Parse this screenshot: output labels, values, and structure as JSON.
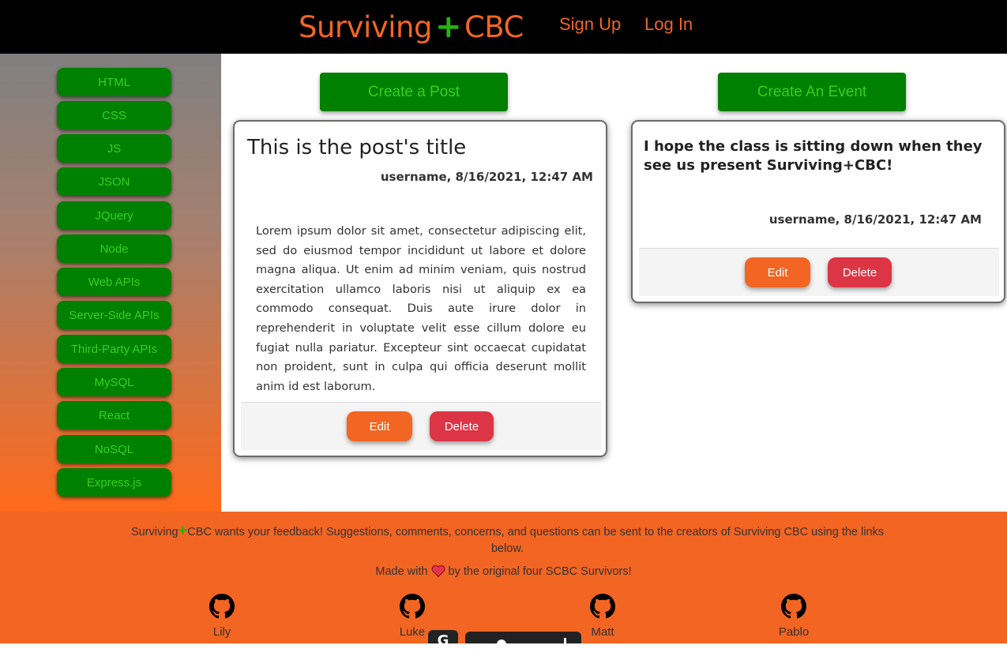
{
  "header": {
    "brand_left": "Surviving",
    "brand_plus": "+",
    "brand_right": "CBC",
    "signup": "Sign Up",
    "login": "Log In"
  },
  "sidebar": {
    "items": [
      {
        "label": "HTML"
      },
      {
        "label": "CSS"
      },
      {
        "label": "JS"
      },
      {
        "label": "JSON"
      },
      {
        "label": "JQuery"
      },
      {
        "label": "Node"
      },
      {
        "label": "Web APIs"
      },
      {
        "label": "Server-Side APIs"
      },
      {
        "label": "Third-Party APIs"
      },
      {
        "label": "MySQL"
      },
      {
        "label": "React"
      },
      {
        "label": "NoSQL"
      },
      {
        "label": "Express.js"
      }
    ]
  },
  "main": {
    "create_post": "Create a Post",
    "create_event": "Create An Event",
    "post": {
      "title": "This is the post's title",
      "meta": "username, 8/16/2021, 12:47 AM",
      "body": "Lorem ipsum dolor sit amet, consectetur adipiscing elit, sed do eiusmod tempor incididunt ut labore et dolore magna aliqua. Ut enim ad minim veniam, quis nostrud exercitation ullamco laboris nisi ut aliquip ex ea commodo consequat. Duis aute irure dolor in reprehenderit in voluptate velit esse cillum dolore eu fugiat nulla pariatur. Excepteur sint occaecat cupidatat non proident, sunt in culpa qui officia deserunt mollit anim id est laborum.",
      "edit": "Edit",
      "delete": "Delete"
    },
    "event": {
      "text": "I hope the class is sitting down when they see us present Surviving+CBC!",
      "meta": "username, 8/16/2021, 12:47 AM",
      "edit": "Edit",
      "delete": "Delete"
    }
  },
  "footer": {
    "feedback_a": "Surviving",
    "feedback_plus": "+",
    "feedback_b": "CBC wants your feedback! Suggestions, comments, concerns, and questions can be sent to the creators of Surviving CBC using the links below.",
    "made_a": "Made with",
    "made_b": "by the original four SCBC Survivors!",
    "heart_icon": "heart-icon",
    "creators": [
      {
        "name": "Lily",
        "icon": "github-icon"
      },
      {
        "name": "Luke",
        "icon": "github-icon"
      },
      {
        "name": "Matt",
        "icon": "github-icon"
      },
      {
        "name": "Pablo",
        "icon": "github-icon"
      }
    ]
  },
  "colors": {
    "orange": "#f26522",
    "green": "#008000",
    "green_text": "#37cf1f",
    "red": "#dc3545",
    "black": "#000000"
  }
}
